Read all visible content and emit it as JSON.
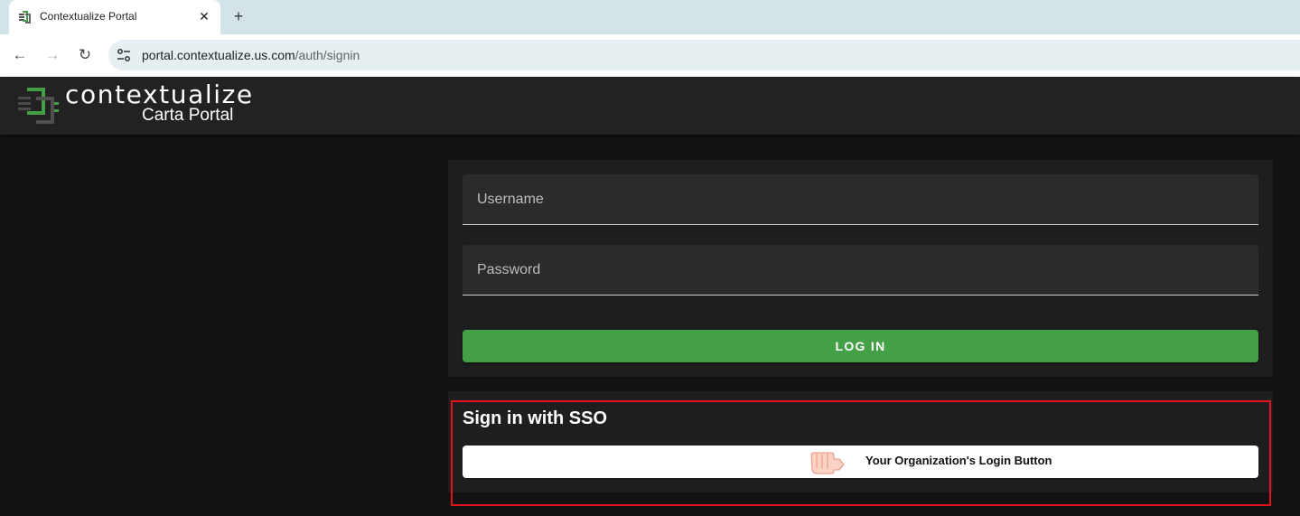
{
  "browser": {
    "tab_title": "Contextualize Portal",
    "close_glyph": "✕",
    "new_tab_glyph": "+",
    "back_glyph": "←",
    "forward_glyph": "→",
    "reload_glyph": "↻",
    "url_host": "portal.contextualize.us.com",
    "url_path": "/auth/signin"
  },
  "header": {
    "brand_name": "contextualize",
    "product_name": "Carta Portal",
    "brand_color": "#43a047"
  },
  "login_form": {
    "username_placeholder": "Username",
    "password_placeholder": "Password",
    "login_button_label": "LOG IN",
    "button_color": "#43a047"
  },
  "sso": {
    "title": "Sign in with SSO",
    "button_label": "Your Organization's Login Button",
    "button_icon": "pointing-hand-icon",
    "highlight_color": "#e3121b"
  }
}
